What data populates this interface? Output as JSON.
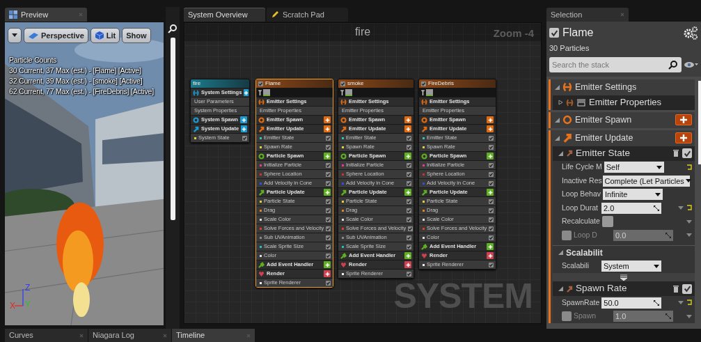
{
  "preview": {
    "tab": "Preview",
    "toolbar": [
      {
        "kind": "menu"
      },
      {
        "kind": "perspective",
        "label": "Perspective"
      },
      {
        "kind": "lit",
        "label": "Lit"
      },
      {
        "kind": "plain",
        "label": "Show"
      }
    ],
    "stats": [
      "Particle Counts",
      "30 Current, 37 Max (est.) - [Flame] [Active]",
      "32 Current, 39 Max (est.) - [smoke] [Active]",
      "62 Current, 77 Max (est.) - [FireDebris] [Active]"
    ],
    "axes": [
      {
        "label": "X",
        "color": "#e02828"
      },
      {
        "label": "Y",
        "color": "#30c030"
      },
      {
        "label": "Z",
        "color": "#3040f0"
      }
    ]
  },
  "graph": {
    "tabs": [
      {
        "label": "System Overview",
        "selected": true,
        "kind": "overview"
      },
      {
        "label": "Scratch Pad",
        "selected": false,
        "kind": "scratch"
      }
    ],
    "title": "fire",
    "zoom": "Zoom -4",
    "watermark": "SYSTEM",
    "nodes": [
      {
        "title": "fire",
        "kind": "system",
        "selected": false,
        "rows": [
          {
            "kind": "settings",
            "label": "System Settings",
            "color": "#1a9ad0",
            "add": true
          },
          {
            "kind": "property",
            "label": "User Parameters"
          },
          {
            "kind": "property",
            "label": "System Properties"
          },
          {
            "kind": "spawn",
            "label": "System Spawn",
            "color": "#1a9ad0",
            "add": true
          },
          {
            "kind": "update",
            "label": "System Update",
            "color": "#1a9ad0",
            "add": true
          },
          {
            "kind": "module",
            "label": "System State",
            "color": "#e0d040",
            "checked": true
          }
        ]
      },
      {
        "title": "Flame",
        "kind": "emitter",
        "enabled": true,
        "selected": true,
        "rows": [
          {
            "kind": "settings",
            "label": "Emitter Settings",
            "color": "#e06a10",
            "add": false
          },
          {
            "kind": "property",
            "label": "Emitter Properties"
          },
          {
            "kind": "spawn",
            "label": "Emitter Spawn",
            "color": "#e06a10",
            "add": true
          },
          {
            "kind": "update",
            "label": "Emitter Update",
            "color": "#e06a10",
            "add": true
          },
          {
            "kind": "module",
            "label": "Emitter State",
            "color": "#30c0c0",
            "checked": true
          },
          {
            "kind": "module",
            "label": "Spawn Rate",
            "color": "#e0d040",
            "checked": true
          },
          {
            "kind": "spawn",
            "label": "Particle Spawn",
            "color": "#5fb020",
            "add": true
          },
          {
            "kind": "module",
            "label": "Initialize Particle",
            "color": "#e04080",
            "checked": true
          },
          {
            "kind": "module",
            "label": "Sphere Location",
            "color": "#d03030",
            "checked": true
          },
          {
            "kind": "module",
            "label": "Add Velocity in Cone",
            "color": "#3050e0",
            "checked": true
          },
          {
            "kind": "update",
            "label": "Particle Update",
            "color": "#5fb020",
            "add": true
          },
          {
            "kind": "module",
            "label": "Particle State",
            "color": "#e0d040",
            "checked": true
          },
          {
            "kind": "module",
            "label": "Drag",
            "color": "#e08020",
            "checked": true
          },
          {
            "kind": "module",
            "label": "Scale Color",
            "color": "#dddddd",
            "checked": true
          },
          {
            "kind": "module",
            "label": "Solve Forces and Velocity",
            "color": "#e04020",
            "checked": true
          },
          {
            "kind": "module",
            "label": "Sub UVAnimation",
            "color": "#888888",
            "checked": true
          },
          {
            "kind": "module",
            "label": "Scale Sprite Size",
            "color": "#20c0c0",
            "checked": true
          },
          {
            "kind": "module",
            "label": "Color",
            "color": "#dddddd",
            "checked": true
          },
          {
            "kind": "event",
            "label": "Add Event Handler",
            "color": "#5fb020",
            "add": true
          },
          {
            "kind": "render",
            "label": "Render",
            "color": "#d04050",
            "add": true
          },
          {
            "kind": "module",
            "label": "Sprite Renderer",
            "color": "#eeeeee",
            "checked": true
          }
        ]
      },
      {
        "title": "smoke",
        "kind": "emitter",
        "enabled": true,
        "selected": false,
        "rows": [
          {
            "kind": "settings",
            "label": "Emitter Settings",
            "color": "#e06a10",
            "add": false
          },
          {
            "kind": "property",
            "label": "Emitter Properties"
          },
          {
            "kind": "spawn",
            "label": "Emitter Spawn",
            "color": "#e06a10",
            "add": true
          },
          {
            "kind": "update",
            "label": "Emitter Update",
            "color": "#e06a10",
            "add": true
          },
          {
            "kind": "module",
            "label": "Emitter State",
            "color": "#30c0c0",
            "checked": true
          },
          {
            "kind": "module",
            "label": "Spawn Rate",
            "color": "#e0d040",
            "checked": true
          },
          {
            "kind": "spawn",
            "label": "Particle Spawn",
            "color": "#5fb020",
            "add": true
          },
          {
            "kind": "module",
            "label": "Initialize Particle",
            "color": "#e04080",
            "checked": true
          },
          {
            "kind": "module",
            "label": "Sphere Location",
            "color": "#d03030",
            "checked": true
          },
          {
            "kind": "module",
            "label": "Add Velocity in Cone",
            "color": "#3050e0",
            "checked": true
          },
          {
            "kind": "update",
            "label": "Particle Update",
            "color": "#5fb020",
            "add": true
          },
          {
            "kind": "module",
            "label": "Particle State",
            "color": "#e0d040",
            "checked": true
          },
          {
            "kind": "module",
            "label": "Drag",
            "color": "#e08020",
            "checked": true
          },
          {
            "kind": "module",
            "label": "Scale Color",
            "color": "#dddddd",
            "checked": true
          },
          {
            "kind": "module",
            "label": "Solve Forces and Velocity",
            "color": "#e04020",
            "checked": true
          },
          {
            "kind": "module",
            "label": "Sub UVAnimation",
            "color": "#888888",
            "checked": true
          },
          {
            "kind": "module",
            "label": "Scale Sprite Size",
            "color": "#20c0c0",
            "checked": true
          },
          {
            "kind": "event",
            "label": "Add Event Handler",
            "color": "#5fb020",
            "add": true
          },
          {
            "kind": "render",
            "label": "Render",
            "color": "#d04050",
            "add": true
          },
          {
            "kind": "module",
            "label": "Sprite Renderer",
            "color": "#eeeeee",
            "checked": true
          }
        ]
      },
      {
        "title": "FireDebris",
        "kind": "emitter",
        "enabled": true,
        "selected": false,
        "rows": [
          {
            "kind": "settings",
            "label": "Emitter Settings",
            "color": "#e06a10",
            "add": false
          },
          {
            "kind": "property",
            "label": "Emitter Properties"
          },
          {
            "kind": "spawn",
            "label": "Emitter Spawn",
            "color": "#e06a10",
            "add": true
          },
          {
            "kind": "update",
            "label": "Emitter Update",
            "color": "#e06a10",
            "add": true
          },
          {
            "kind": "module",
            "label": "Emitter State",
            "color": "#30c0c0",
            "checked": true
          },
          {
            "kind": "module",
            "label": "Spawn Rate",
            "color": "#e0d040",
            "checked": true
          },
          {
            "kind": "spawn",
            "label": "Particle Spawn",
            "color": "#5fb020",
            "add": true
          },
          {
            "kind": "module",
            "label": "Initialize Particle",
            "color": "#e04080",
            "checked": true
          },
          {
            "kind": "module",
            "label": "Sphere Location",
            "color": "#d03030",
            "checked": true
          },
          {
            "kind": "module",
            "label": "Add Velocity in Cone",
            "color": "#3050e0",
            "checked": true
          },
          {
            "kind": "update",
            "label": "Particle Update",
            "color": "#5fb020",
            "add": true
          },
          {
            "kind": "module",
            "label": "Particle State",
            "color": "#e0d040",
            "checked": true
          },
          {
            "kind": "module",
            "label": "Drag",
            "color": "#e08020",
            "checked": true
          },
          {
            "kind": "module",
            "label": "Scale Color",
            "color": "#dddddd",
            "checked": true
          },
          {
            "kind": "module",
            "label": "Solve Forces and Velocity",
            "color": "#e04020",
            "checked": true
          },
          {
            "kind": "module",
            "label": "Color",
            "color": "#dddddd",
            "checked": true
          },
          {
            "kind": "event",
            "label": "Add Event Handler",
            "color": "#5fb020",
            "add": true
          },
          {
            "kind": "render",
            "label": "Render",
            "color": "#d04050",
            "add": true
          },
          {
            "kind": "module",
            "label": "Sprite Renderer",
            "color": "#eeeeee",
            "checked": true
          }
        ]
      }
    ]
  },
  "selection": {
    "tab": "Selection",
    "emitter": {
      "label": "Flame",
      "checked": true
    },
    "count": "30 Particles",
    "search": {
      "placeholder": "Search the stack"
    },
    "stack": [
      {
        "kind": "settings",
        "label": "Emitter Settings",
        "expanded": true,
        "add": false,
        "children": [
          {
            "kind": "item",
            "label": "Emitter Properties",
            "expanded": false
          }
        ]
      },
      {
        "kind": "spawn",
        "label": "Emitter Spawn",
        "expanded": true,
        "add": true
      },
      {
        "kind": "update",
        "label": "Emitter Update",
        "expanded": true,
        "add": true,
        "children": [
          {
            "kind": "module",
            "label": "Emitter State",
            "expanded": true,
            "checked": true,
            "params": [
              {
                "kind": "dropdown",
                "label": "Life Cycle M",
                "value": "Self",
                "enabled": true,
                "reset": true
              },
              {
                "kind": "dropdown",
                "label": "Inactive Res",
                "value": "Complete (Let Particles",
                "enabled": true,
                "reset": false
              },
              {
                "kind": "dropdown",
                "label": "Loop Behav",
                "value": "Infinite",
                "enabled": true,
                "reset": false
              },
              {
                "kind": "number",
                "label": "Loop Durat",
                "value": "2.0",
                "enabled": true,
                "reset": true
              },
              {
                "kind": "checkbox",
                "label": "Recalculate",
                "checked": false
              },
              {
                "kind": "number",
                "label": "Loop D",
                "value": "0.0",
                "enabled": false,
                "reset": false
              },
              {
                "kind": "heading",
                "label": "Scalabilit",
                "expanded": true
              },
              {
                "kind": "dropdown",
                "label": "Scalabili",
                "value": "System",
                "enabled": true,
                "reset": false
              },
              {
                "kind": "more"
              }
            ]
          },
          {
            "kind": "module",
            "label": "Spawn Rate",
            "expanded": true,
            "checked": true,
            "params": [
              {
                "kind": "number",
                "label": "SpawnRate",
                "value": "50.0",
                "enabled": true,
                "reset": true
              },
              {
                "kind": "number",
                "label": "Spawn",
                "value": "1.0",
                "enabled": false,
                "reset": false
              }
            ]
          }
        ]
      }
    ]
  },
  "bottom_tabs": [
    {
      "label": "Curves",
      "selected": false
    },
    {
      "label": "Niagara Log",
      "selected": false
    },
    {
      "label": "Timeline",
      "selected": true
    }
  ]
}
